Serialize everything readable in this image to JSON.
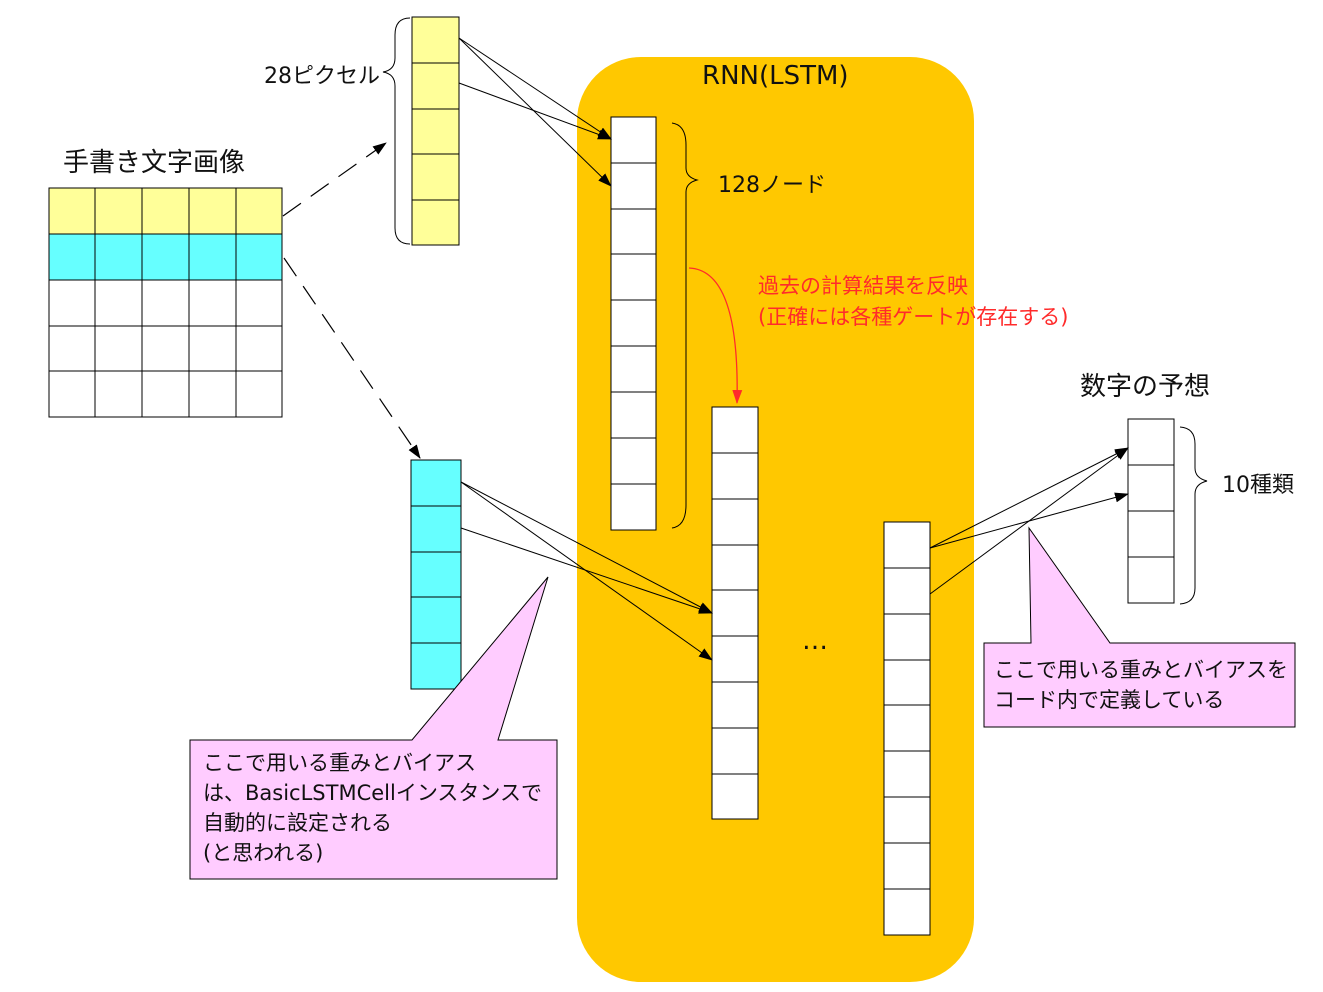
{
  "title_image": "手書き文字画像",
  "label_pixels": "28ピクセル",
  "rnn_title": "RNN(LSTM)",
  "label_nodes": "128ノード",
  "memory_note": [
    "過去の計算結果を反映",
    "(正確には各種ゲートが存在する)"
  ],
  "ellipsis": "…",
  "title_prediction": "数字の予想",
  "label_classes": "10種類",
  "callout_left": [
    "ここで用いる重みとバイアス",
    "は、BasicLSTMCellインスタンスで",
    "自動的に設定される",
    "(と思われる)"
  ],
  "callout_right": [
    "ここで用いる重みとバイアスを",
    "コード内で定義している"
  ],
  "colors": {
    "rnn_box": "#ffc800",
    "row_yellow": "#ffff99",
    "row_cyan": "#66ffff",
    "callout_fill": "#ffccff",
    "note_red": "#ff2b2b"
  }
}
